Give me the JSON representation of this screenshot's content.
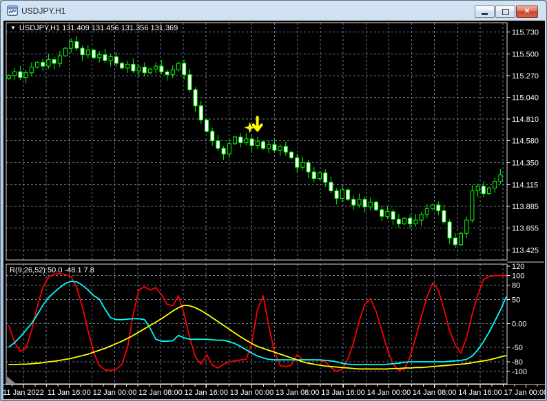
{
  "window": {
    "title": "USDJPY,H1",
    "controls": {
      "minimize_icon": "minimize",
      "restore_icon": "restore",
      "close_icon": "✕"
    }
  },
  "main_chart": {
    "dropdown_icon": "▼",
    "ohlc_header": "USDJPY,H1 131.409 131.456 131.356 131.369"
  },
  "indicator_pane": {
    "label": "R(9,26,52) 50.0 -48.1 7.8"
  },
  "colors": {
    "background": "#000000",
    "grid": "#6b7d8f",
    "pane_border": "#d8d8d8",
    "text": "#ffffff",
    "candle_outline": "#00FF00",
    "bull_fill": "#000000",
    "bear_fill": "#ffffff",
    "signal": "#FFFF00"
  },
  "chart_data": {
    "type": "candlestick",
    "symbol": "USDJPY",
    "timeframe": "H1",
    "ohlc_display": {
      "open": "131.409",
      "high": "131.456",
      "low": "131.356",
      "close": "131.369"
    },
    "price_axis": {
      "range": [
        113.318,
        115.83
      ],
      "ticks": [
        "115.730",
        "115.500",
        "115.270",
        "115.040",
        "114.810",
        "114.580",
        "114.350",
        "114.115",
        "113.885",
        "113.655",
        "113.425"
      ]
    },
    "time_axis": {
      "labels": [
        "11 Jan 2022",
        "11 Jan 16:00",
        "12 Jan 00:00",
        "12 Jan 08:00",
        "12 Jan 16:00",
        "13 Jan 00:00",
        "13 Jan 08:00",
        "13 Jan 16:00",
        "14 Jan 00:00",
        "14 Jan 08:00",
        "14 Jan 16:00",
        "17 Jan 00:00"
      ]
    },
    "candles": {
      "first_open": 115.24,
      "closes": [
        115.27,
        115.31,
        115.25,
        115.3,
        115.36,
        115.41,
        115.37,
        115.44,
        115.4,
        115.48,
        115.56,
        115.63,
        115.56,
        115.49,
        115.54,
        115.46,
        115.49,
        115.43,
        115.47,
        115.4,
        115.35,
        115.39,
        115.32,
        115.36,
        115.3,
        115.34,
        115.37,
        115.31,
        115.28,
        115.33,
        115.4,
        115.28,
        115.12,
        114.95,
        114.8,
        114.68,
        114.58,
        114.5,
        114.44,
        114.55,
        114.62,
        114.56,
        114.6,
        114.53,
        114.57,
        114.5,
        114.54,
        114.48,
        114.52,
        114.46,
        114.4,
        114.3,
        114.35,
        114.25,
        114.18,
        114.24,
        114.14,
        114.05,
        113.97,
        114.06,
        113.96,
        113.9,
        113.96,
        113.88,
        113.93,
        113.85,
        113.78,
        113.83,
        113.75,
        113.7,
        113.76,
        113.7,
        113.74,
        113.8,
        113.86,
        113.9,
        113.84,
        113.72,
        113.55,
        113.48,
        113.6,
        113.74,
        114.05,
        114.1,
        114.02,
        114.08,
        114.15,
        114.22,
        114.33
      ]
    },
    "oscillator": {
      "label": "R(9,26,52) 50.0 -48.1 7.8",
      "range": [
        -126,
        124
      ],
      "scale_ticks": [
        {
          "v": 120,
          "t": "120"
        },
        {
          "v": 100,
          "t": "100"
        },
        {
          "v": 80,
          "t": "80"
        },
        {
          "v": 50,
          "t": "50"
        },
        {
          "v": 0,
          "t": "0.00"
        },
        {
          "v": -50,
          "t": "-50"
        },
        {
          "v": -80,
          "t": "-80"
        },
        {
          "v": -100,
          "t": "-100"
        }
      ],
      "levels": [
        100,
        80,
        50,
        0,
        -50,
        -80,
        -100
      ],
      "series": [
        {
          "name": "fast",
          "color": "#FF0000",
          "values": [
            -5,
            -40,
            -58,
            -52,
            -15,
            35,
            75,
            97,
            103,
            104,
            102,
            98,
            75,
            35,
            -15,
            -60,
            -88,
            -97,
            -98,
            -96,
            -85,
            -50,
            20,
            70,
            77,
            70,
            75,
            60,
            40,
            37,
            58,
            20,
            -30,
            -70,
            -85,
            -65,
            -87,
            -93,
            -85,
            -80,
            -78,
            -76,
            -75,
            -40,
            30,
            58,
            -5,
            -60,
            -88,
            -90,
            -87,
            -65,
            -75,
            -76,
            -76,
            -77,
            -80,
            -92,
            -100,
            -95,
            -75,
            -40,
            5,
            40,
            52,
            25,
            -15,
            -55,
            -85,
            -98,
            -95,
            -70,
            -30,
            15,
            55,
            85,
            70,
            30,
            -15,
            -45,
            -62,
            -30,
            20,
            60,
            92,
            98,
            100,
            100,
            100
          ]
        },
        {
          "name": "mid",
          "color": "#00FFFF",
          "values": [
            -49,
            -40,
            -28,
            -14,
            0,
            18,
            38,
            54,
            65,
            75,
            84,
            88,
            87,
            80,
            70,
            58,
            51,
            30,
            12,
            8,
            8,
            9,
            10,
            10,
            8,
            -10,
            -33,
            -37,
            -37,
            -36,
            -25,
            -30,
            -33,
            -33,
            -33,
            -33,
            -34,
            -35,
            -35,
            -38,
            -42,
            -48,
            -55,
            -62,
            -68,
            -72,
            -75,
            -76,
            -76,
            -76,
            -76,
            -76,
            -76,
            -76,
            -76,
            -76,
            -77,
            -78,
            -80,
            -83,
            -85,
            -86,
            -86,
            -86,
            -86,
            -86,
            -86,
            -85,
            -84,
            -83,
            -81,
            -80,
            -80,
            -80,
            -80,
            -80,
            -80,
            -80,
            -79,
            -78,
            -77,
            -75,
            -68,
            -55,
            -38,
            -18,
            5,
            28,
            55
          ]
        },
        {
          "name": "slow",
          "color": "#FFFF00",
          "values": [
            -86,
            -86,
            -85,
            -85,
            -84,
            -83,
            -82,
            -80,
            -79,
            -77,
            -75,
            -73,
            -70,
            -67,
            -64,
            -60,
            -56,
            -52,
            -47,
            -42,
            -37,
            -31,
            -25,
            -18,
            -11,
            -4,
            3,
            10,
            18,
            26,
            33,
            38,
            37,
            33,
            27,
            20,
            12,
            4,
            -4,
            -12,
            -20,
            -28,
            -35,
            -42,
            -48,
            -52,
            -56,
            -60,
            -64,
            -68,
            -72,
            -76,
            -80,
            -83,
            -85,
            -87,
            -89,
            -90,
            -91,
            -92,
            -93,
            -94,
            -95,
            -95,
            -95,
            -95,
            -95,
            -95,
            -94,
            -94,
            -93,
            -93,
            -92,
            -92,
            -91,
            -90,
            -89,
            -88,
            -87,
            -86,
            -85,
            -84,
            -82,
            -80,
            -78,
            -76,
            -73,
            -70,
            -67
          ]
        }
      ]
    },
    "signal": {
      "shape": "star-and-down-arrow",
      "color": "#FFFF00",
      "bar_index": 43,
      "price": 114.72
    }
  }
}
